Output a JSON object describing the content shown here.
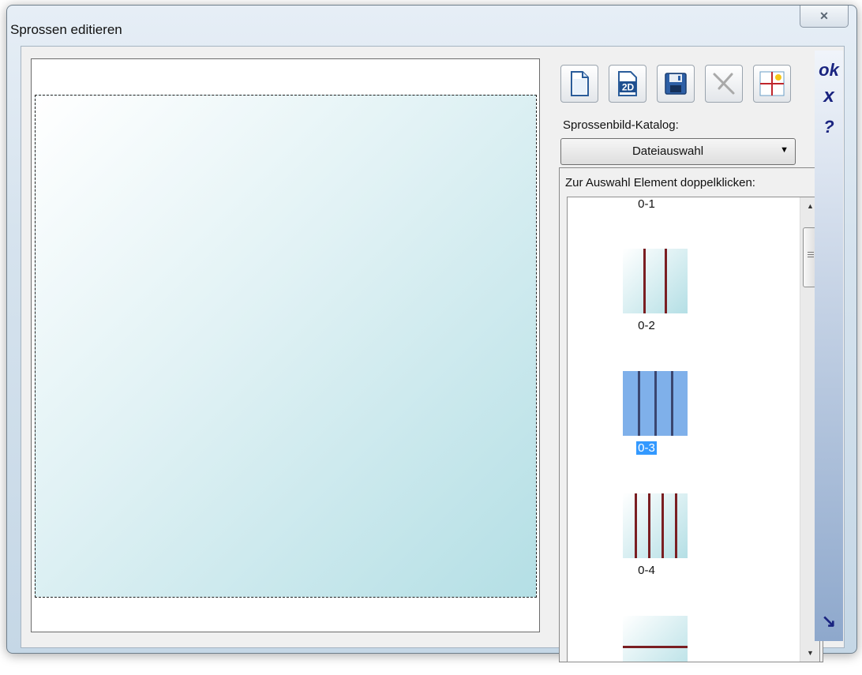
{
  "window": {
    "title": "Sprossen editieren",
    "close_glyph": "✕"
  },
  "toolbar": {
    "buttons": [
      {
        "name": "new-file-icon"
      },
      {
        "name": "2d-icon",
        "text": "2D"
      },
      {
        "name": "save-icon"
      },
      {
        "name": "delete-icon",
        "disabled": true
      },
      {
        "name": "add-cross-icon"
      }
    ]
  },
  "catalog": {
    "label": "Sprossenbild-Katalog:",
    "dropdown_value": "Dateiauswahl",
    "instruction": "Zur Auswahl Element doppelklicken:",
    "items": [
      {
        "caption": "0-1",
        "vertical_bars": 0,
        "horizontal_bars": 0
      },
      {
        "caption": "0-2",
        "vertical_bars": 2,
        "horizontal_bars": 0
      },
      {
        "caption": "0-3",
        "vertical_bars": 3,
        "horizontal_bars": 0,
        "selected": true
      },
      {
        "caption": "0-4",
        "vertical_bars": 4,
        "horizontal_bars": 0
      },
      {
        "caption": "",
        "vertical_bars": 0,
        "horizontal_bars": 1
      }
    ]
  },
  "sidebar": {
    "ok": "ok",
    "cancel": "x",
    "help": "?",
    "expand": "↘"
  },
  "colors": {
    "bar": "#7a1e22",
    "glass_top": "#ffffff",
    "glass_bottom": "#b4dfe5",
    "selection": "#3399ff",
    "sidebar_text": "#1a2480"
  }
}
